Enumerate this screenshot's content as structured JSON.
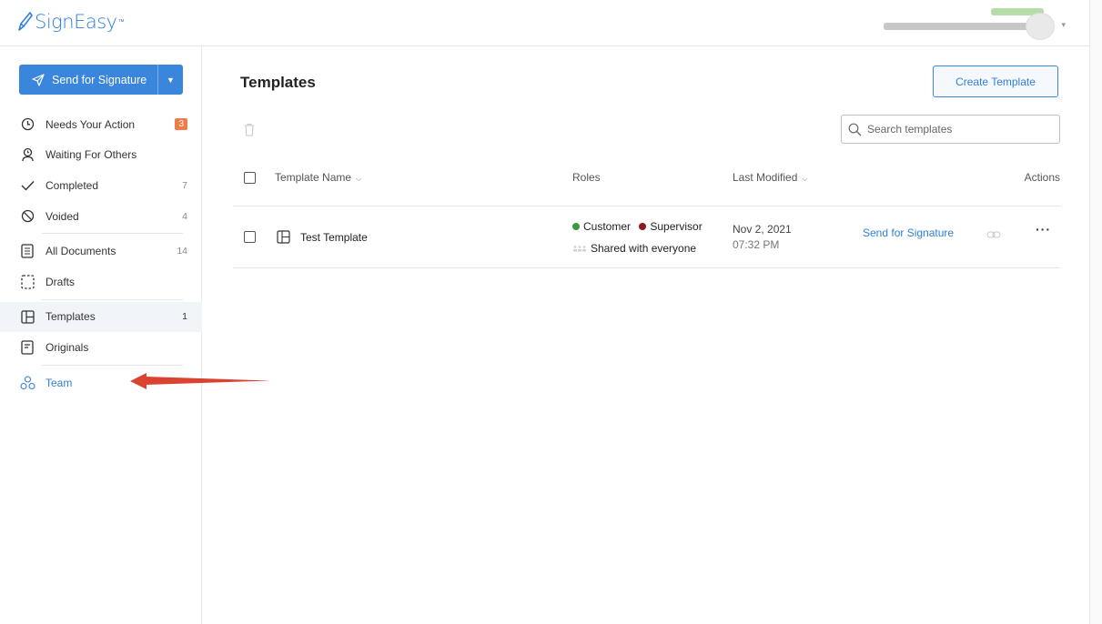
{
  "header": {
    "logo_text": "SignEasy",
    "logo_tm": "™",
    "upgrade_text": "",
    "business_name": ""
  },
  "sidebar": {
    "send_button_label": "Send for Signature",
    "items": [
      {
        "label": "Needs Your Action",
        "count": "3",
        "icon": "clock-icon"
      },
      {
        "label": "Waiting For Others",
        "count": "",
        "icon": "person-wait-icon"
      },
      {
        "label": "Completed",
        "count": "7",
        "icon": "check-icon"
      },
      {
        "label": "Voided",
        "count": "4",
        "icon": "void-icon"
      },
      {
        "label": "All Documents",
        "count": "14",
        "icon": "documents-icon"
      },
      {
        "label": "Drafts",
        "count": "",
        "icon": "draft-icon"
      },
      {
        "label": "Templates",
        "count": "1",
        "icon": "template-icon"
      },
      {
        "label": "Originals",
        "count": "",
        "icon": "original-icon"
      },
      {
        "label": "Team",
        "count": "",
        "icon": "team-icon"
      }
    ]
  },
  "main": {
    "title": "Templates",
    "create_button_label": "Create Template",
    "search": {
      "placeholder": "Search templates",
      "value": ""
    },
    "columns": {
      "name": "Template Name",
      "roles": "Roles",
      "modified": "Last Modified",
      "actions": "Actions"
    },
    "rows": [
      {
        "name": "Test Template",
        "roles": [
          {
            "name": "Customer",
            "color": "#3a9a3a"
          },
          {
            "name": "Supervisor",
            "color": "#8b1a1a"
          }
        ],
        "shared": "Shared with everyone",
        "date": "Nov 2, 2021",
        "time": "07:32 PM",
        "action_label": "Send for Signature"
      }
    ]
  },
  "colors": {
    "accent": "#3b86dd",
    "badge": "#ef7d4a",
    "annotation_arrow": "#d9432f"
  }
}
